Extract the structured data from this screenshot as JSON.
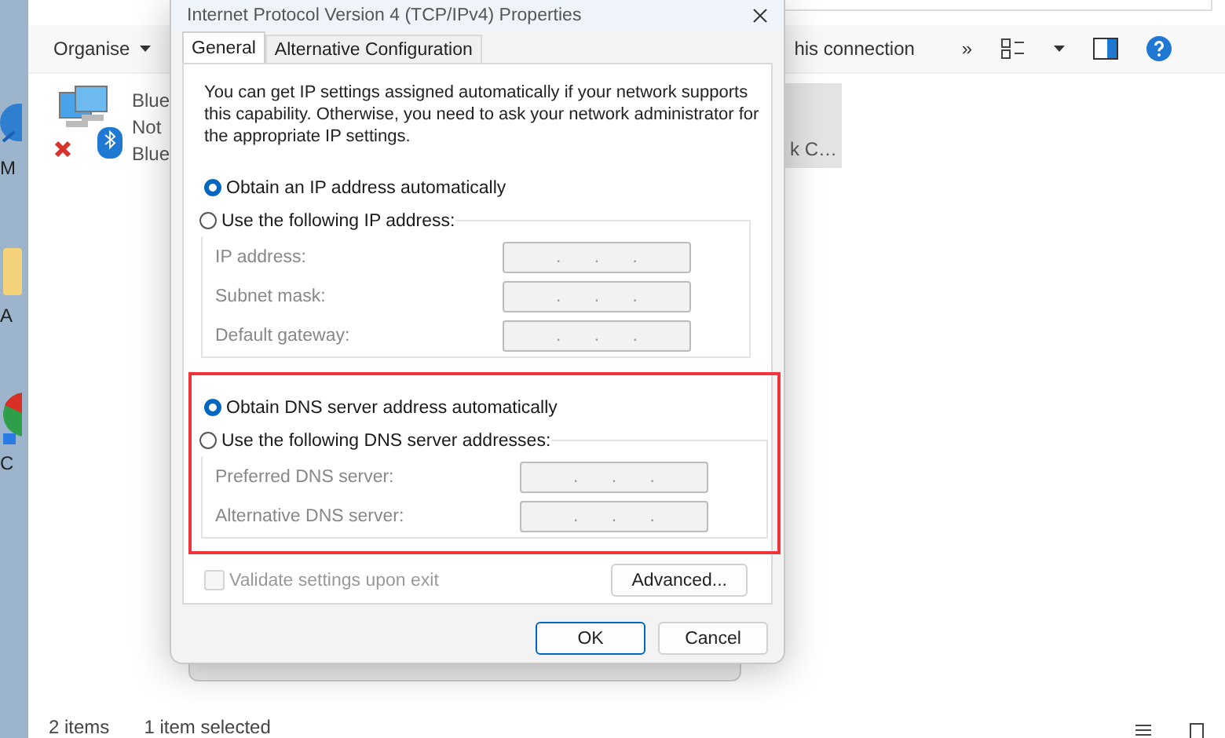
{
  "desktop_icons": [
    {
      "kind": "edge",
      "label": "M"
    },
    {
      "kind": "folder",
      "label": "A"
    },
    {
      "kind": "chrome",
      "label": "C"
    }
  ],
  "explorer": {
    "toolbar": {
      "organise": "Organise",
      "action": "his connection",
      "more": "»"
    },
    "items": [
      {
        "lines": [
          "Blue",
          "Not",
          "Blue"
        ],
        "selected": false
      },
      {
        "lines": [
          "k C…"
        ],
        "selected": true
      }
    ],
    "status_bar": {
      "count": "2 items",
      "selection": "1 item selected"
    }
  },
  "dialog": {
    "title": "Internet Protocol Version 4 (TCP/IPv4) Properties",
    "tabs": [
      {
        "label": "General",
        "selected": true
      },
      {
        "label": "Alternative Configuration",
        "selected": false
      }
    ],
    "description": "You can get IP settings assigned automatically if your network supports this capability. Otherwise, you need to ask your network administrator for the appropriate IP settings.",
    "ip": {
      "options": [
        {
          "label": "Obtain an IP address automatically",
          "selected": true
        },
        {
          "label": "Use the following IP address:",
          "selected": false
        }
      ],
      "fields": [
        {
          "label": "IP address:",
          "value": ". . ."
        },
        {
          "label": "Subnet mask:",
          "value": ". . ."
        },
        {
          "label": "Default gateway:",
          "value": ". . ."
        }
      ]
    },
    "dns": {
      "highlight": true,
      "options": [
        {
          "label": "Obtain DNS server address automatically",
          "selected": true
        },
        {
          "label": "Use the following DNS server addresses:",
          "selected": false
        }
      ],
      "fields": [
        {
          "label": "Preferred DNS server:",
          "value": ". . ."
        },
        {
          "label": "Alternative DNS server:",
          "value": ". . ."
        }
      ]
    },
    "validate": {
      "label": "Validate settings upon exit",
      "checked": false,
      "disabled": true
    },
    "advanced": "Advanced...",
    "buttons": [
      {
        "label": "OK",
        "kind": "default"
      },
      {
        "label": "Cancel",
        "kind": "normal"
      }
    ]
  }
}
